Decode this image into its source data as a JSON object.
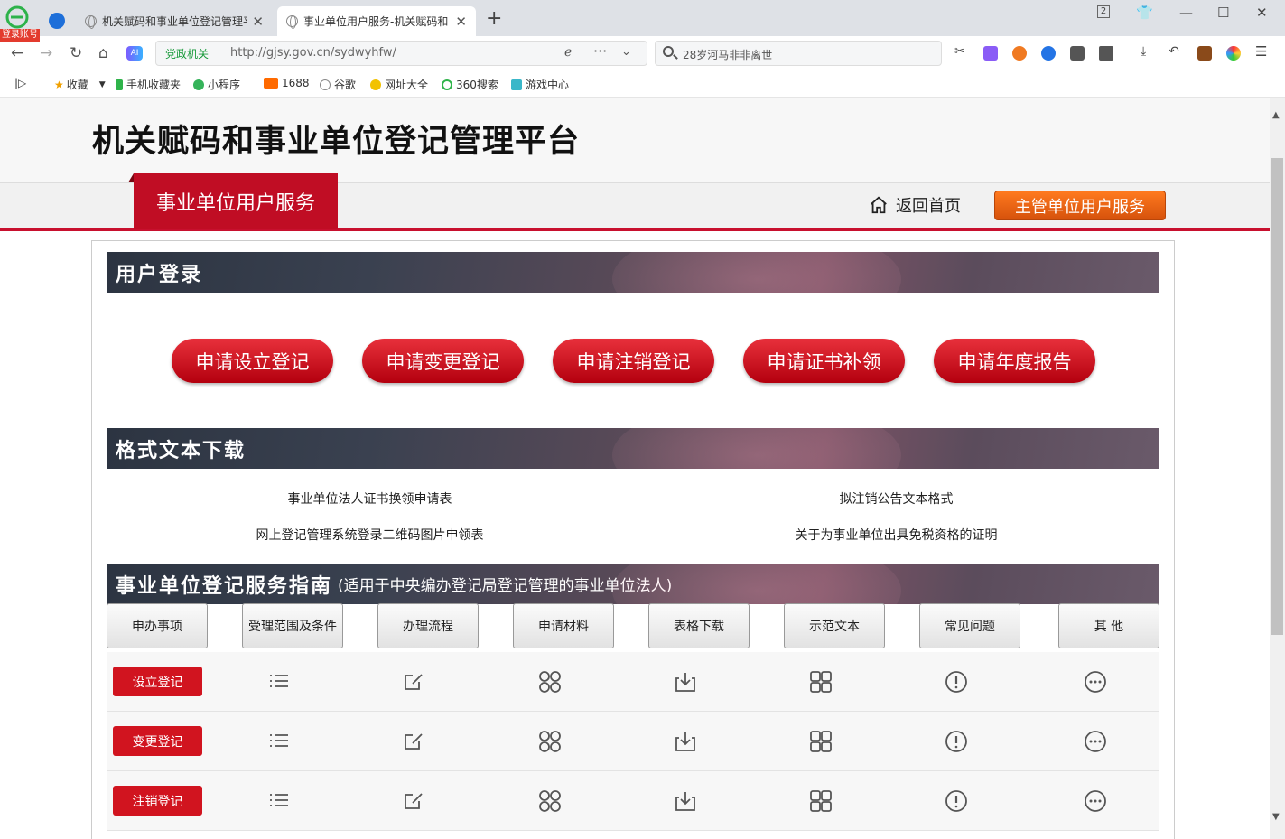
{
  "browser": {
    "login_badge": "登录账号",
    "tabs": [
      {
        "title": "机关赋码和事业单位登记管理平台"
      },
      {
        "title": "事业单位用户服务-机关赋码和"
      }
    ],
    "tab_close": "✕",
    "new_tab": "+",
    "window_badge": "2",
    "secure_label": "党政机关",
    "url": "http://gjsy.gov.cn/sydwyhfw/",
    "search_text": "28岁河马非非离世",
    "ai_label": "AI",
    "bookmarks": [
      "收藏",
      "手机收藏夹",
      "小程序",
      "1688",
      "谷歌",
      "网址大全",
      "360搜索",
      "游戏中心"
    ]
  },
  "site": {
    "title": "机关赋码和事业单位登记管理平台",
    "nav_active": "事业单位用户服务",
    "home_link": "返回首页",
    "supervisor_button": "主管单位用户服务"
  },
  "login_section": {
    "title": "用户登录",
    "buttons": [
      "申请设立登记",
      "申请变更登记",
      "申请注销登记",
      "申请证书补领",
      "申请年度报告"
    ]
  },
  "download_section": {
    "title": "格式文本下载",
    "links": [
      "事业单位法人证书换领申请表",
      "拟注销公告文本格式",
      "网上登记管理系统登录二维码图片申领表",
      "关于为事业单位出具免税资格的证明"
    ]
  },
  "guide_section": {
    "title": "事业单位登记服务指南",
    "subtitle": "(适用于中央编办登记局登记管理的事业单位法人)",
    "columns": [
      "申办事项",
      "受理范围及条件",
      "办理流程",
      "申请材料",
      "表格下载",
      "示范文本",
      "常见问题",
      "其 他"
    ],
    "rows": [
      "设立登记",
      "变更登记",
      "注销登记"
    ],
    "icons": [
      "list-icon",
      "edit-icon",
      "materials-icon",
      "download-icon",
      "template-icon",
      "faq-icon",
      "more-icon"
    ]
  },
  "colors": {
    "accent_red": "#c8102e",
    "supervisor_orange": "#e8641a"
  }
}
